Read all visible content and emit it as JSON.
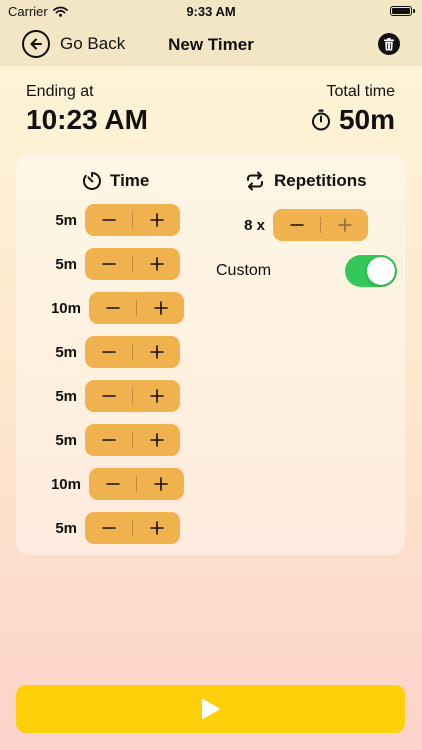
{
  "status_bar": {
    "carrier": "Carrier",
    "time": "9:33 AM"
  },
  "nav": {
    "back_label": "Go Back",
    "title": "New Timer"
  },
  "summary": {
    "ending_label": "Ending at",
    "ending_value": "10:23 AM",
    "total_label": "Total time",
    "total_value": "50m"
  },
  "time_column": {
    "header": "Time",
    "rows": [
      {
        "label": "5m"
      },
      {
        "label": "5m"
      },
      {
        "label": "10m"
      },
      {
        "label": "5m"
      },
      {
        "label": "5m"
      },
      {
        "label": "5m"
      },
      {
        "label": "10m"
      },
      {
        "label": "5m"
      }
    ]
  },
  "repetitions": {
    "header": "Repetitions",
    "count_label": "8 x"
  },
  "custom": {
    "label": "Custom",
    "enabled": true
  },
  "colors": {
    "accent": "#f0b24f",
    "toggle_on": "#34c759",
    "play_button": "#ffd00a",
    "header_bg": "#f3e6c5"
  },
  "icons": {
    "back": "arrow-left-circle-icon",
    "trash": "trash-icon",
    "stopwatch": "stopwatch-icon",
    "timer": "timer-icon",
    "repeat": "repeat-icon",
    "play": "play-icon"
  }
}
